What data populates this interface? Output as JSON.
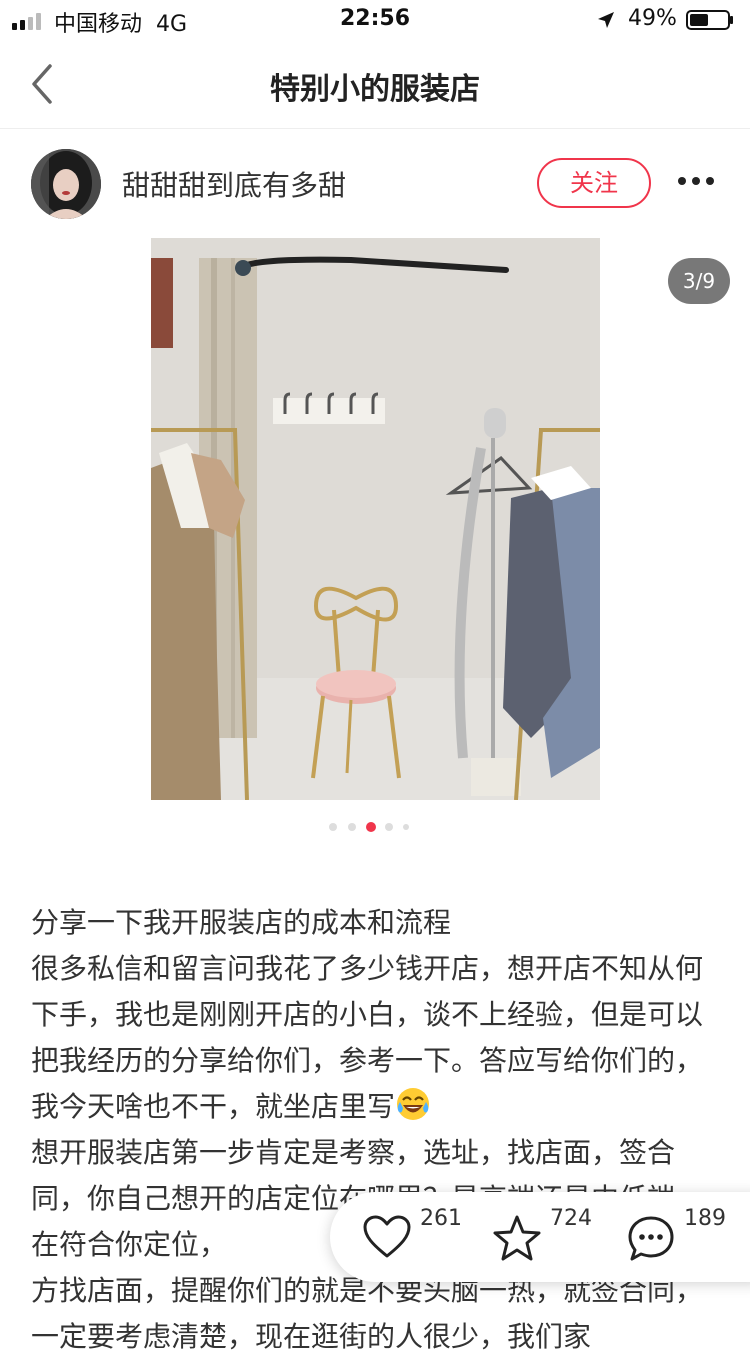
{
  "status_bar": {
    "carrier": "中国移动",
    "network": "4G",
    "time": "22:56",
    "battery_percent": "49%",
    "battery_level": 0.49
  },
  "nav": {
    "title": "特别小的服装店",
    "back_icon": "chevron-left-icon"
  },
  "author": {
    "name": "甜甜甜到底有多甜",
    "follow_label": "关注",
    "more_icon": "more-dots-icon"
  },
  "gallery": {
    "counter": "3/9",
    "current_index": 3,
    "total": 9,
    "visible_dots": 5,
    "active_dot": 3
  },
  "post": {
    "lines": [
      "分享一下我开服装店的成本和流程",
      "很多私信和留言问我花了多少钱开店，想开店不知从何下手，我也是刚刚开店的小白，谈不上经验，但是可以把我经历的分享给你们，参考一下。答应写给你们的，我今天啥也不干，就坐店里写",
      "想开服装店第一步肯定是考察，选址，找店面，签合同，你自己想开的店定位在哪里？是高端还是中低端，在符合你定位，",
      "方找店面，提醒你们的就是不要头脑一热，就签合同，一定要考虑清楚，现在逛街的人很少，我们家"
    ],
    "emoji": "laughing-tears-emoji"
  },
  "actions": {
    "likes": "261",
    "favorites": "724",
    "comments": "189"
  },
  "colors": {
    "accent": "#f0354b",
    "text": "#333333"
  }
}
